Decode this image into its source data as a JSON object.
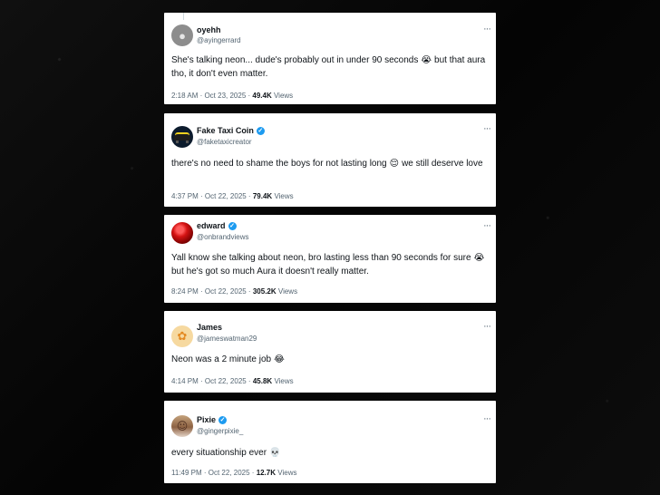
{
  "tweets": [
    {
      "display_name": "oyehh",
      "handle": "@ayingerrard",
      "verified": false,
      "avatar_icon": "gray-avatar-icon",
      "text": "She's talking neon... dude's probably out in under 90 seconds",
      "emoji": "😭",
      "text_after": "but that aura tho, it don't even matter.",
      "time": "2:18 AM · Oct 23, 2025 ·",
      "views_count": "49.4K",
      "views_label": "Views"
    },
    {
      "display_name": "Fake Taxi Coin",
      "handle": "@faketaxicreator",
      "verified": true,
      "avatar_icon": "taxi-car-icon",
      "text": "there's no need to shame the boys for not lasting long",
      "emoji": "😌",
      "text_after": "we still deserve love",
      "time": "4:37 PM · Oct 22, 2025 ·",
      "views_count": "79.4K",
      "views_label": "Views"
    },
    {
      "display_name": "edward",
      "handle": "@onbrandviews",
      "verified": true,
      "avatar_icon": "red-orb-icon",
      "text": "Yall know she talking about neon, bro lasting less than 90 seconds for sure",
      "emoji": "😭",
      "text_after": "but he's got so much Aura it doesn't really matter.",
      "time": "8:24 PM · Oct 22, 2025 ·",
      "views_count": "305.2K",
      "views_label": "Views"
    },
    {
      "display_name": "James",
      "handle": "@jameswatman29",
      "verified": false,
      "avatar_icon": "cat-avatar-icon",
      "text": "Neon was a 2 minute job",
      "emoji": "😂",
      "text_after": "",
      "time": "4:14 PM · Oct 22, 2025 ·",
      "views_count": "45.8K",
      "views_label": "Views"
    },
    {
      "display_name": "Pixie",
      "handle": "@gingerpixie_",
      "verified": true,
      "avatar_icon": "person-avatar-icon",
      "text": "every situationship ever",
      "emoji": "💀",
      "text_after": "",
      "time": "11:49 PM · Oct 22, 2025 ·",
      "views_count": "12.7K",
      "views_label": "Views"
    }
  ],
  "ui": {
    "more_glyph": "···",
    "verified_glyph": "✓",
    "colors": {
      "background": "#060606",
      "card": "#ffffff",
      "text": "#0f1419",
      "muted": "#536471",
      "verified": "#1d9bf0"
    }
  }
}
